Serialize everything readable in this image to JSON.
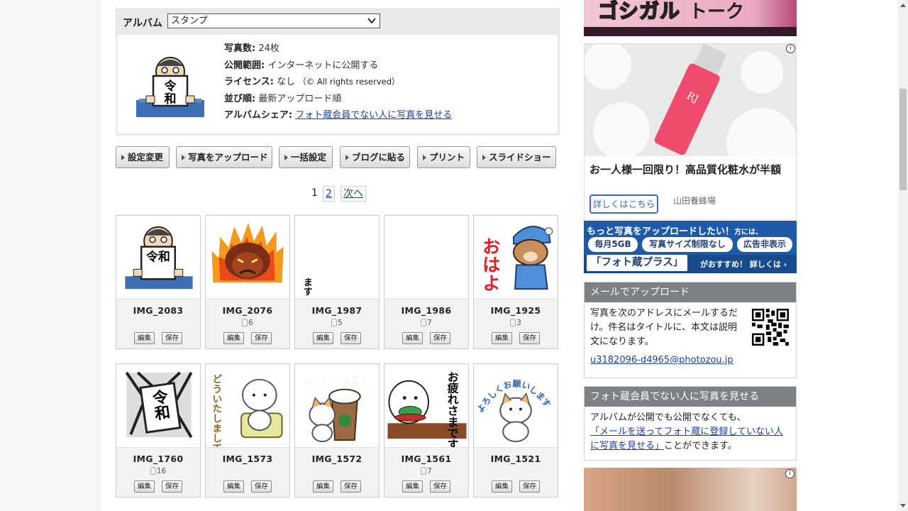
{
  "album": {
    "label": "アルバム",
    "selected": "スタンプ"
  },
  "info": {
    "photos_label": "写真数:",
    "photos_value": "24枚",
    "scope_label": "公開範囲:",
    "scope_value": "インターネットに公開する",
    "license_label": "ライセンス:",
    "license_value": "なし",
    "license_note": "（© All rights reserved）",
    "order_label": "並び順:",
    "order_value": "最新アップロード順",
    "share_label": "アルバムシェア:",
    "share_link": "フォト蔵会員でない人に写真を見せる"
  },
  "actions": [
    "設定変更",
    "写真をアップロード",
    "一括設定",
    "ブログに貼る",
    "プリント",
    "スライドショー"
  ],
  "pager": {
    "current": "1",
    "page2": "2",
    "next": "次へ"
  },
  "photos": [
    {
      "name": "IMG_2083",
      "count": "",
      "edit": "編集",
      "save": "保存"
    },
    {
      "name": "IMG_2076",
      "count": "6",
      "edit": "編集",
      "save": "保存"
    },
    {
      "name": "IMG_1987",
      "count": "5",
      "edit": "編集",
      "save": "保存"
    },
    {
      "name": "IMG_1986",
      "count": "7",
      "edit": "編集",
      "save": "保存"
    },
    {
      "name": "IMG_1925",
      "count": "3",
      "edit": "編集",
      "save": "保存"
    },
    {
      "name": "IMG_1760",
      "count": "16",
      "edit": "編集",
      "save": "保存"
    },
    {
      "name": "IMG_1573",
      "count": "",
      "edit": "編集",
      "save": "保存"
    },
    {
      "name": "IMG_1572",
      "count": "",
      "edit": "編集",
      "save": "保存"
    },
    {
      "name": "IMG_1561",
      "count": "7",
      "edit": "編集",
      "save": "保存"
    },
    {
      "name": "IMG_1521",
      "count": "",
      "edit": "編集",
      "save": "保存"
    }
  ],
  "stamps": {
    "reiwa": "令和",
    "masu": "ます",
    "ohayo": "おはよ",
    "reiwa_big": "令和",
    "douitashi": "どういたしまして",
    "otsukare": "お疲れさまです",
    "otsukare2": "お疲れさまです",
    "yoroshiku": "よろしくお願いします"
  },
  "sidebar": {
    "top_banner_a": "ゴシガル",
    "top_banner_b": "トーク",
    "ad_title": "お一人様一回限り！高品質化粧水が半額",
    "ad_button": "詳しくはこちら",
    "ad_sponsor": "山田養蜂場",
    "ad_info": "i",
    "plus_line1": "もっと写真をアップロードしたい！",
    "plus_line1_small": "方には、",
    "plus_pill1": "毎月5GB",
    "plus_pill2": "写真サイズ制限なし",
    "plus_pill3": "広告非表示",
    "plus_big": "「フォト蔵プラス」",
    "plus_rest": "がおすすめ！ 詳しくは ›",
    "mail_header": "メールでアップロード",
    "mail_text": "写真を次のアドレスにメールするだけ。件名はタイトルに、本文は説明文になります。",
    "mail_address": "u3182096-d4965@photozou.jp",
    "share_header": "フォト蔵会員でない人に写真を見せる",
    "share_text1": "アルバムが公開でも公開でなくても、",
    "share_link": "「メールを送ってフォト蔵に登録していない人に写真を見せる」",
    "share_text2": "ことができます。"
  },
  "colors": {
    "link": "#1a3fa8",
    "sidebar_header": "#7d8084",
    "plus_blue": "#1e5aa8"
  }
}
